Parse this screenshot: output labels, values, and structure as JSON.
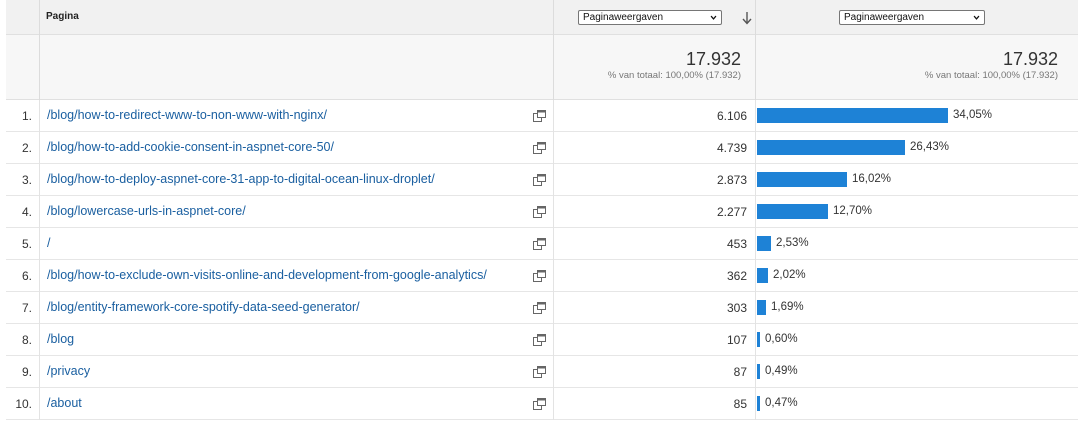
{
  "header": {
    "page_column_title": "Pagina",
    "metric_select_1": "Paginaweergaven",
    "metric_select_2": "Paginaweergaven"
  },
  "totals": {
    "value_1": "17.932",
    "sub_1": "% van totaal: 100,00% (17.932)",
    "value_2": "17.932",
    "sub_2": "% van totaal: 100,00% (17.932)"
  },
  "rows": [
    {
      "num": "1.",
      "page": "/blog/how-to-redirect-www-to-non-www-with-nginx/",
      "views": "6.106",
      "pct": "34,05%",
      "share": 0.3405
    },
    {
      "num": "2.",
      "page": "/blog/how-to-add-cookie-consent-in-aspnet-core-50/",
      "views": "4.739",
      "pct": "26,43%",
      "share": 0.2643
    },
    {
      "num": "3.",
      "page": "/blog/how-to-deploy-aspnet-core-31-app-to-digital-ocean-linux-droplet/",
      "views": "2.873",
      "pct": "16,02%",
      "share": 0.1602
    },
    {
      "num": "4.",
      "page": "/blog/lowercase-urls-in-aspnet-core/",
      "views": "2.277",
      "pct": "12,70%",
      "share": 0.127
    },
    {
      "num": "5.",
      "page": "/",
      "views": "453",
      "pct": "2,53%",
      "share": 0.0253
    },
    {
      "num": "6.",
      "page": "/blog/how-to-exclude-own-visits-online-and-development-from-google-analytics/",
      "views": "362",
      "pct": "2,02%",
      "share": 0.0202
    },
    {
      "num": "7.",
      "page": "/blog/entity-framework-core-spotify-data-seed-generator/",
      "views": "303",
      "pct": "1,69%",
      "share": 0.0169
    },
    {
      "num": "8.",
      "page": "/blog",
      "views": "107",
      "pct": "0,60%",
      "share": 0.006
    },
    {
      "num": "9.",
      "page": "/privacy",
      "views": "87",
      "pct": "0,49%",
      "share": 0.0049
    },
    {
      "num": "10.",
      "page": "/about",
      "views": "85",
      "pct": "0,47%",
      "share": 0.0047
    }
  ],
  "colors": {
    "bar": "#1e82d6",
    "link": "#1a5fa0"
  },
  "icons": {
    "sort": "arrow-down-icon",
    "external": "open-in-new-window-icon",
    "dropdown": "chevron-down-icon"
  }
}
